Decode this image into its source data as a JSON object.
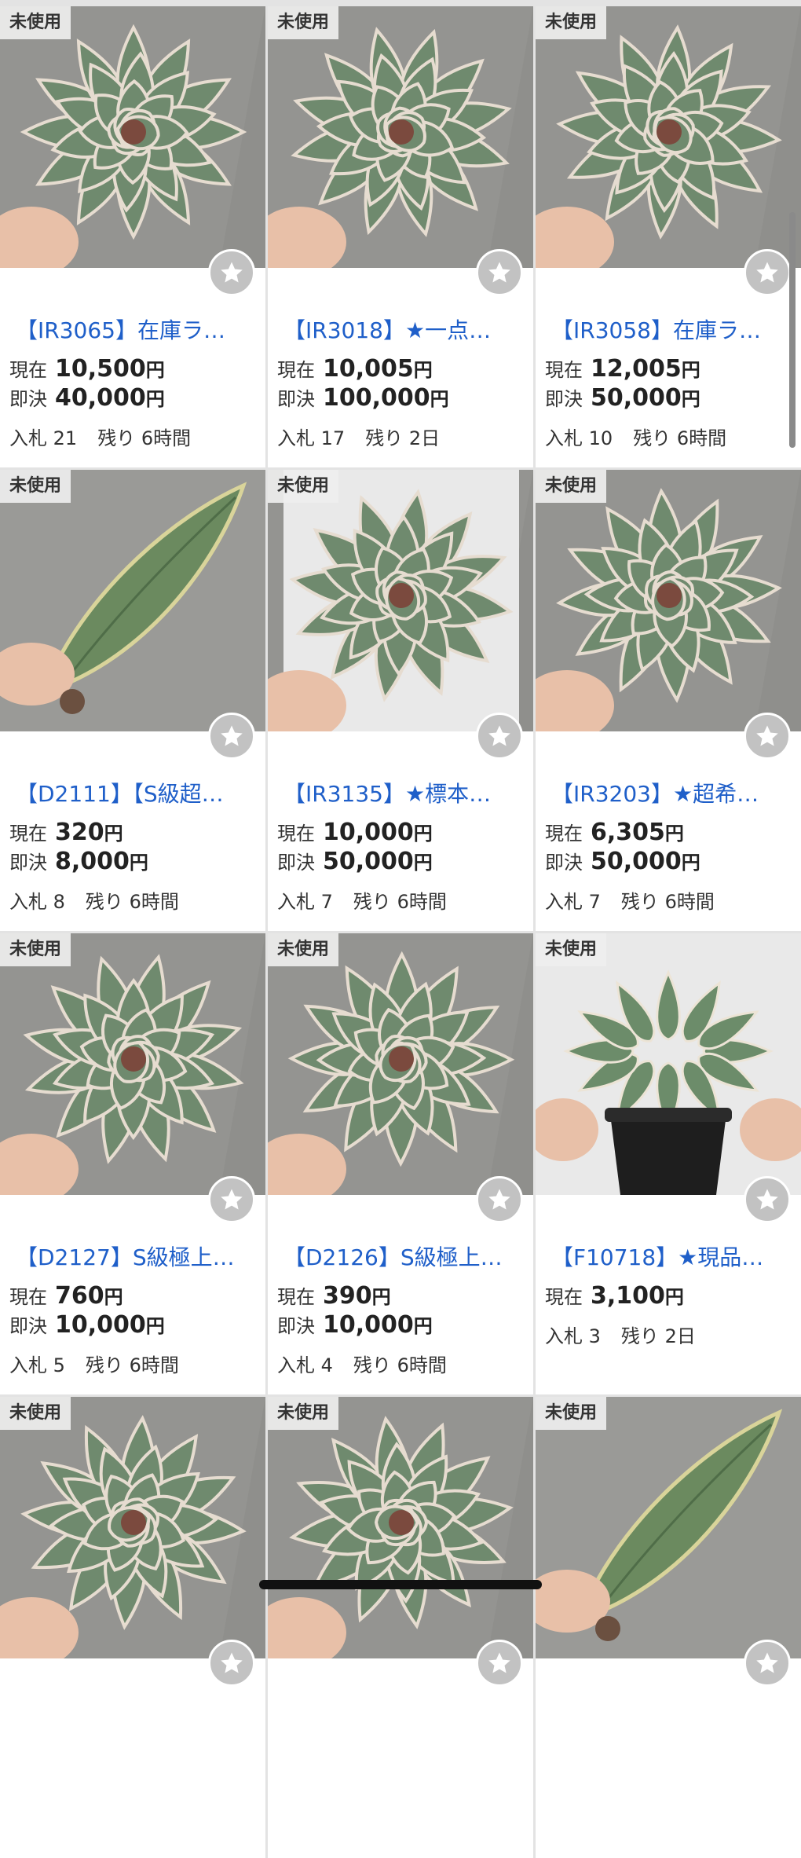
{
  "badge_label": "未使用",
  "labels": {
    "current": "現在",
    "buynow": "即決",
    "bids": "入札",
    "remaining": "残り",
    "yen": "円"
  },
  "colors": {
    "title_blue": "#1f5fc9",
    "fav_gray": "#c2c2c2",
    "badge_bg": "#eeeeee"
  },
  "listings": [
    {
      "title": "【IR3065】在庫ラ…",
      "current_price": "10,500",
      "buynow_price": "40,000",
      "bids": "21",
      "remaining": "6時間",
      "plant": "rosette"
    },
    {
      "title": "【IR3018】★一点…",
      "current_price": "10,005",
      "buynow_price": "100,000",
      "bids": "17",
      "remaining": "2日",
      "plant": "rosette"
    },
    {
      "title": "【IR3058】在庫ラ…",
      "current_price": "12,005",
      "buynow_price": "50,000",
      "bids": "10",
      "remaining": "6時間",
      "plant": "rosette"
    },
    {
      "title": "【D2111】【S級超…",
      "current_price": "320",
      "buynow_price": "8,000",
      "bids": "8",
      "remaining": "6時間",
      "plant": "leaf"
    },
    {
      "title": "【IR3135】★標本…",
      "current_price": "10,000",
      "buynow_price": "50,000",
      "bids": "7",
      "remaining": "6時間",
      "plant": "rosette"
    },
    {
      "title": "【IR3203】★超希…",
      "current_price": "6,305",
      "buynow_price": "50,000",
      "bids": "7",
      "remaining": "6時間",
      "plant": "rosette"
    },
    {
      "title": "【D2127】S級極上…",
      "current_price": "760",
      "buynow_price": "10,000",
      "bids": "5",
      "remaining": "6時間",
      "plant": "rosette"
    },
    {
      "title": "【D2126】S級極上…",
      "current_price": "390",
      "buynow_price": "10,000",
      "bids": "4",
      "remaining": "6時間",
      "plant": "rosette"
    },
    {
      "title": "【F10718】★現品…",
      "current_price": "3,100",
      "buynow_price": null,
      "bids": "3",
      "remaining": "2日",
      "plant": "pot"
    },
    {
      "title": "",
      "current_price": null,
      "buynow_price": null,
      "bids": null,
      "remaining": null,
      "plant": "rosette"
    },
    {
      "title": "",
      "current_price": null,
      "buynow_price": null,
      "bids": null,
      "remaining": null,
      "plant": "rosette"
    },
    {
      "title": "",
      "current_price": null,
      "buynow_price": null,
      "bids": null,
      "remaining": null,
      "plant": "leaf"
    }
  ]
}
